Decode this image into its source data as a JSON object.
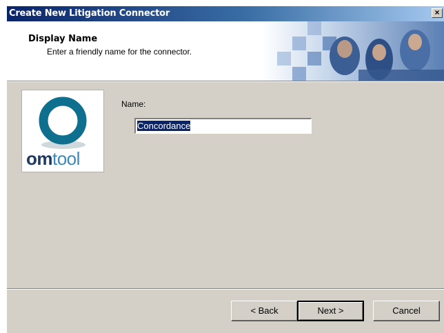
{
  "window": {
    "title": "Create New Litigation Connector",
    "close_label": "×"
  },
  "header": {
    "title": "Display Name",
    "subtitle": "Enter a friendly name for the connector."
  },
  "logo": {
    "om": "om",
    "tool": "tool",
    "ring_color": "#0e6f8e",
    "om_color": "#1f3a60",
    "tool_color": "#3c88b8"
  },
  "form": {
    "name_label": "Name:",
    "name_value": "Concordance"
  },
  "buttons": {
    "back": "< Back",
    "next": "Next >",
    "cancel": "Cancel"
  }
}
